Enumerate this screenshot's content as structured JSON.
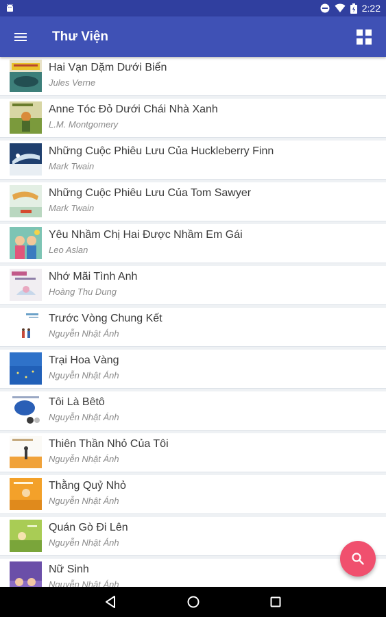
{
  "status_bar": {
    "time": "2:22",
    "icons": [
      "android-icon",
      "do-not-disturb-icon",
      "wifi-icon",
      "battery-icon"
    ]
  },
  "app_bar": {
    "title": "Thư Viện",
    "menu_icon": "hamburger-menu-icon",
    "view_icon": "grid-view-icon",
    "color": "#3f51b5"
  },
  "books": [
    {
      "title": "Hai Vạn Dặm Dưới Biển",
      "author": "Jules Verne"
    },
    {
      "title": "Anne Tóc Đỏ Dưới Chái Nhà Xanh",
      "author": "L.M. Montgomery"
    },
    {
      "title": "Những Cuộc Phiêu Lưu Của Huckleberry Finn",
      "author": "Mark Twain"
    },
    {
      "title": "Những Cuộc Phiêu Lưu Của Tom Sawyer",
      "author": "Mark Twain"
    },
    {
      "title": "Yêu Nhầm Chị Hai Được Nhầm Em Gái",
      "author": "Leo Aslan"
    },
    {
      "title": "Nhớ Mãi Tình Anh",
      "author": "Hoàng Thu Dung"
    },
    {
      "title": "Trước Vòng Chung Kết",
      "author": "Nguyễn Nhật Ánh"
    },
    {
      "title": "Trại Hoa Vàng",
      "author": "Nguyễn Nhật Ánh"
    },
    {
      "title": "Tôi Là Bêtô",
      "author": "Nguyễn Nhật Ánh"
    },
    {
      "title": "Thiên Thần Nhỏ Của Tôi",
      "author": "Nguyễn Nhật Ánh"
    },
    {
      "title": "Thằng Quỷ Nhỏ",
      "author": "Nguyễn Nhật Ánh"
    },
    {
      "title": "Quán Gò Đi Lên",
      "author": "Nguyễn Nhật Ánh"
    },
    {
      "title": "Nữ Sinh",
      "author": "Nguyễn Nhật Ánh"
    }
  ],
  "fab": {
    "icon": "search-icon",
    "color": "#f0506e"
  },
  "nav_bar": {
    "icons": [
      "back-icon",
      "home-icon",
      "recents-icon"
    ]
  }
}
